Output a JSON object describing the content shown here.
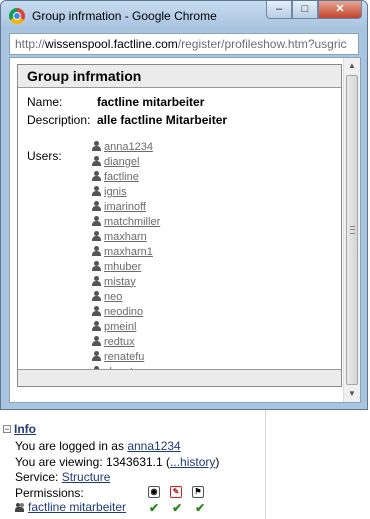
{
  "window": {
    "title": "Group infrmation - Google Chrome",
    "minimize_label": "–",
    "maximize_label": "□",
    "close_label": "✕"
  },
  "address": {
    "scheme": "http://",
    "host": "wissenspool.factline.com",
    "path": "/register/profileshow.htm?usgric"
  },
  "panel": {
    "title": "Group infrmation",
    "name_label": "Name:",
    "name_value": "factline mitarbeiter",
    "description_label": "Description:",
    "description_value": "alle factline Mitarbeiter",
    "users_label": "Users:",
    "users": [
      "anna1234",
      "diangel",
      "factline",
      "ignis",
      "imarinoff",
      "matchmiller",
      "maxharn",
      "maxharn1",
      "mhuber",
      "mistay",
      "neo",
      "neodino",
      "pmeinl",
      "redtux",
      "renatefu",
      "slengteng"
    ]
  },
  "scrollbar": {
    "up_arrow": "▲",
    "down_arrow": "▼"
  },
  "info": {
    "collapse_symbol": "−",
    "title": "Info",
    "logged_in_prefix": "You are logged in as",
    "logged_in_user": "anna1234",
    "viewing_prefix": "You are viewing: 1343631.1",
    "viewing_open": "(",
    "viewing_link": "...history",
    "viewing_close": ")",
    "service_label": "Service:",
    "service_link": "Structure",
    "permissions_label": "Permissions:",
    "group_name": "factline mitarbeiter",
    "permission_icons": [
      "view-icon",
      "edit-icon",
      "manage-icon"
    ],
    "check_symbol": "✔"
  }
}
